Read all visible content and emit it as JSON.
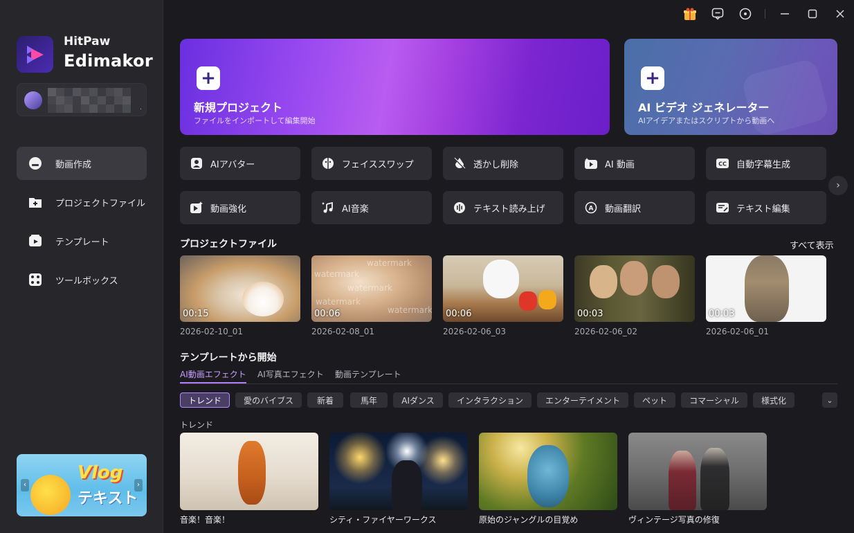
{
  "app": {
    "brand_line1": "HitPaw",
    "brand_line2": "Edimakor"
  },
  "sidebar": {
    "items": [
      {
        "label": "動画作成",
        "icon": "home-icon",
        "active": true
      },
      {
        "label": "プロジェクトファイル",
        "icon": "folder-icon",
        "active": false
      },
      {
        "label": "テンプレート",
        "icon": "template-icon",
        "active": false
      },
      {
        "label": "ツールボックス",
        "icon": "toolbox-icon",
        "active": false
      }
    ],
    "promo": {
      "line1": "Vlog",
      "line2": "テキスト"
    }
  },
  "hero": {
    "new_project": {
      "title": "新規プロジェクト",
      "subtitle": "ファイルをインポートして編集開始",
      "plus": "+"
    },
    "ai_video": {
      "title": "AI ビデオ ジェネレーター",
      "subtitle": "AIアイデアまたはスクリプトから動画へ",
      "plus": "+"
    }
  },
  "tools": [
    {
      "label": "AIアバター",
      "icon": "avatar-icon"
    },
    {
      "label": "フェイススワップ",
      "icon": "face-swap-icon"
    },
    {
      "label": "透かし削除",
      "icon": "watermark-remove-icon"
    },
    {
      "label": "AI 動画",
      "icon": "ai-video-icon"
    },
    {
      "label": "自動字幕生成",
      "icon": "caption-icon"
    },
    {
      "label": "動画強化",
      "icon": "enhance-icon"
    },
    {
      "label": "AI音楽",
      "icon": "ai-music-icon"
    },
    {
      "label": "テキスト読み上げ",
      "icon": "tts-icon"
    },
    {
      "label": "動画翻訳",
      "icon": "translate-icon"
    },
    {
      "label": "テキスト編集",
      "icon": "text-edit-icon"
    }
  ],
  "projects": {
    "title": "プロジェクトファイル",
    "show_all": "すべて表示",
    "items": [
      {
        "duration": "00:15",
        "date": "2026-02-10_01"
      },
      {
        "duration": "00:06",
        "date": "2026-02-08_01"
      },
      {
        "duration": "00:06",
        "date": "2026-02-06_03"
      },
      {
        "duration": "00:03",
        "date": "2026-02-06_02"
      },
      {
        "duration": "00:03",
        "date": "2026-02-06_01"
      }
    ],
    "watermark_text": "watermark"
  },
  "templates": {
    "title": "テンプレートから開始",
    "tabs": [
      {
        "label": "AI動画エフェクト",
        "active": true
      },
      {
        "label": "AI写真エフェクト",
        "active": false
      },
      {
        "label": "動画テンプレート",
        "active": false
      }
    ],
    "chips": [
      "トレンド",
      "愛のバイブス",
      "新着",
      "馬年",
      "AIダンス",
      "インタラクション",
      "エンターテイメント",
      "ペット",
      "コマーシャル",
      "様式化"
    ],
    "active_chip": "トレンド",
    "section_label": "トレンド",
    "items": [
      {
        "caption": "音楽！音楽！"
      },
      {
        "caption": "シティ・ファイヤーワークス"
      },
      {
        "caption": "原始のジャングルの目覚め"
      },
      {
        "caption": "ヴィンテージ写真の修復"
      }
    ]
  },
  "colors": {
    "accent": "#b47cff",
    "background": "#1b1b1f",
    "sidebar": "#26262b",
    "card": "#2c2c32"
  }
}
